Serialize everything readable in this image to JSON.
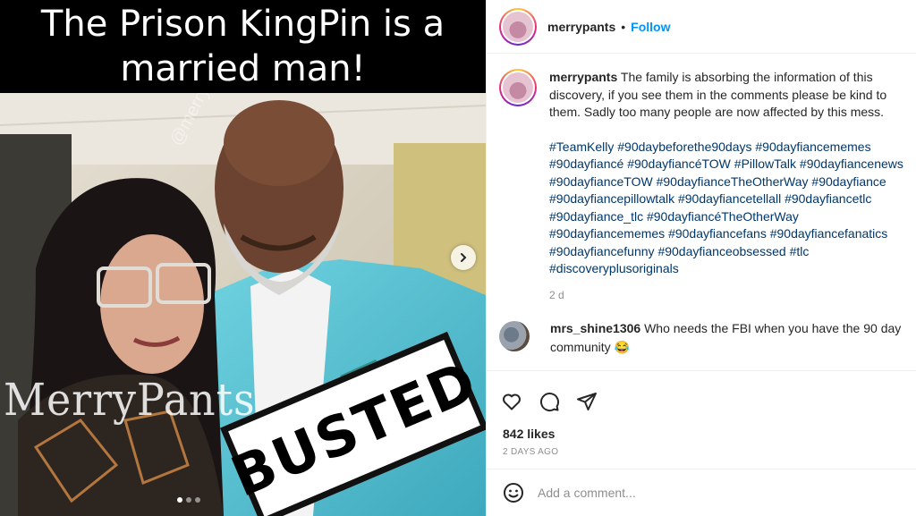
{
  "photo": {
    "caption_line1": "The Prison KingPin is a",
    "caption_line2": "married man!",
    "watermark": "MerryPants",
    "watermark_small": "@merryPants",
    "stamp": "BUSTED",
    "carousel_next_icon": "chevron-right-icon",
    "carousel_slides": 3,
    "carousel_active": 1
  },
  "header": {
    "username": "merrypants",
    "separator": "•",
    "follow_label": "Follow"
  },
  "caption": {
    "username": "merrypants",
    "text": "The family is absorbing the information of this discovery, if you see them in the comments please be kind to them. Sadly too many people are now affected by this mess.",
    "hashtags": [
      "#TeamKelly",
      "#90daybeforethe90days",
      "#90dayfiancememes",
      "#90dayfiancé",
      "#90dayfiancéTOW",
      "#PillowTalk",
      "#90dayfiancenews",
      "#90dayfianceTOW",
      "#90dayfianceTheOtherWay",
      "#90dayfiance",
      "#90dayfiancepillowtalk",
      "#90dayfiancetellall",
      "#90dayfiancetlc",
      "#90dayfiance_tlc",
      "#90dayfiancéTheOtherWay",
      "#90dayfiancememes",
      "#90dayfiancefans",
      "#90dayfiancefanatics",
      "#90dayfiancefunny",
      "#90dayfianceobsessed",
      "#tlc",
      "#discoveryplusoriginals"
    ],
    "age": "2 d"
  },
  "comment": {
    "username": "mrs_shine1306",
    "text": "Who needs the FBI when you have the 90 day community",
    "emoji": "😂"
  },
  "actions": {
    "like_icon": "heart-icon",
    "comment_icon": "comment-bubble-icon",
    "share_icon": "paper-plane-icon"
  },
  "likes": "842 likes",
  "post_date": "2 DAYS AGO",
  "add_comment": {
    "emoji_icon": "smiley-icon",
    "placeholder": "Add a comment..."
  },
  "colors": {
    "link_blue": "#0095f6",
    "hashtag_blue": "#00376b",
    "muted": "#8e8e8e",
    "text": "#262626"
  }
}
